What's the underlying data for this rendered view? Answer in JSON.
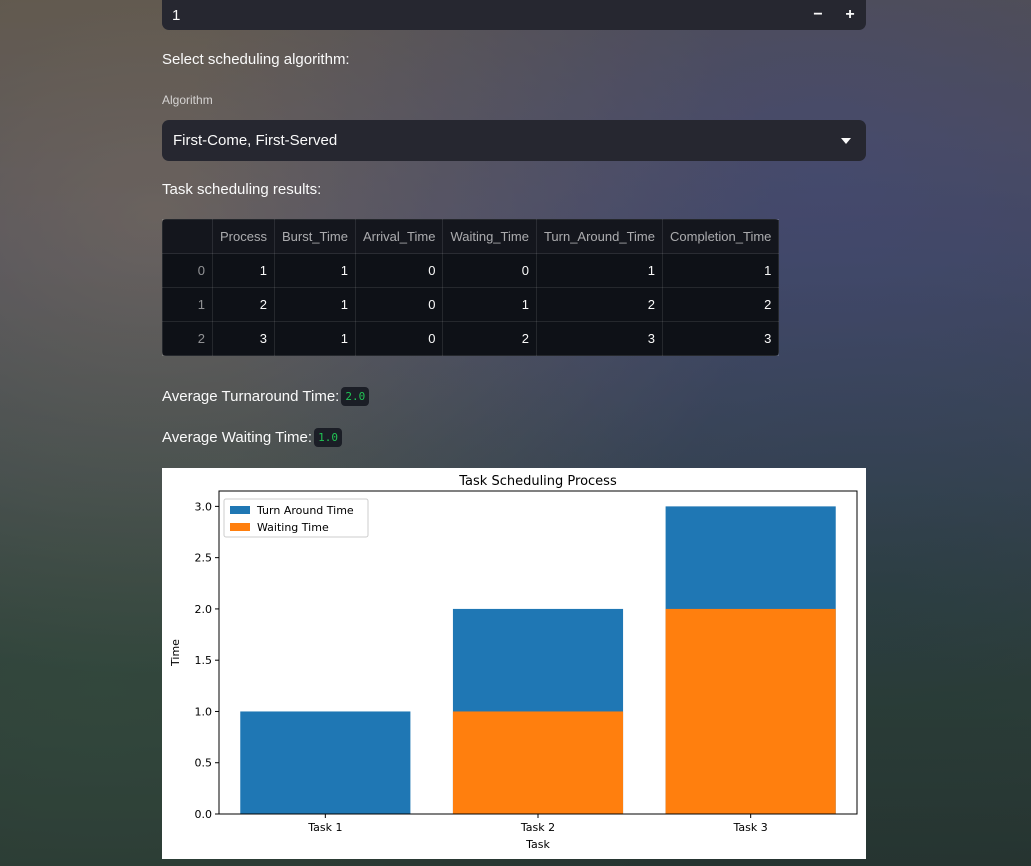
{
  "number_input": {
    "value": "1",
    "decrement_label": "−",
    "increment_label": "+"
  },
  "algorithm_section": {
    "heading": "Select scheduling algorithm:",
    "select_label": "Algorithm",
    "selected_value": "First-Come, First-Served"
  },
  "results": {
    "heading": "Task scheduling results:",
    "columns": [
      "",
      "Process",
      "Burst_Time",
      "Arrival_Time",
      "Waiting_Time",
      "Turn_Around_Time",
      "Completion_Time"
    ],
    "rows": [
      [
        "0",
        "1",
        "1",
        "0",
        "0",
        "1",
        "1"
      ],
      [
        "1",
        "2",
        "1",
        "0",
        "1",
        "2",
        "2"
      ],
      [
        "2",
        "3",
        "1",
        "0",
        "2",
        "3",
        "3"
      ]
    ]
  },
  "metrics": {
    "avg_turnaround_label": "Average Turnaround Time:",
    "avg_turnaround_value": "2.0",
    "avg_waiting_label": "Average Waiting Time:",
    "avg_waiting_value": "1.0"
  },
  "chart_data": {
    "type": "bar",
    "title": "Task Scheduling Process",
    "xlabel": "Task",
    "ylabel": "Time",
    "categories": [
      "Task 1",
      "Task 2",
      "Task 3"
    ],
    "series": [
      {
        "name": "Turn Around Time",
        "values": [
          1,
          2,
          3
        ],
        "color": "#1f77b4"
      },
      {
        "name": "Waiting Time",
        "values": [
          0,
          1,
          2
        ],
        "color": "#ff7f0e"
      }
    ],
    "ylim": [
      0,
      3.15
    ],
    "yticks": [
      "0.0",
      "0.5",
      "1.0",
      "1.5",
      "2.0",
      "2.5",
      "3.0"
    ],
    "legend_position": "top-left",
    "grid": false
  }
}
